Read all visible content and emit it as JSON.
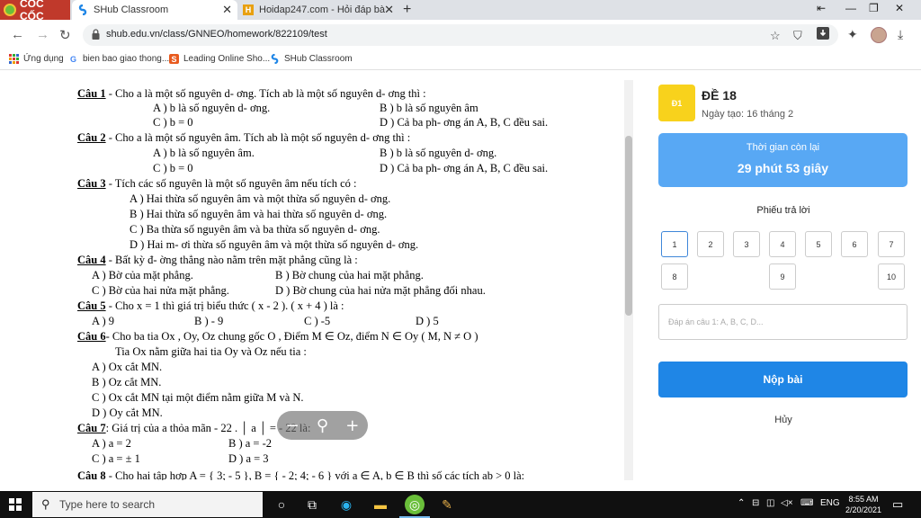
{
  "browser": {
    "brand": "CỐC CỐC",
    "tabs": [
      {
        "title": "SHub Classroom",
        "active": true
      },
      {
        "title": "Hoidap247.com - Hỏi đáp bà",
        "active": false
      }
    ],
    "url": "shub.edu.vn/class/GNNEO/homework/822109/test",
    "bookmarks": [
      "Ứng dụng",
      "bien bao giao thong...",
      "Leading Online Sho...",
      "SHub Classroom"
    ]
  },
  "document": {
    "lines": [
      {
        "label": "Câu 1",
        "text": " -  Cho a là một số nguyên d- ơng. Tích ab là một số nguyên d- ơng thì :"
      },
      {
        "text": "A )      b là số nguyên d- ơng."
      },
      {
        "text": "B )      b là số nguyên âm"
      },
      {
        "text": "C )      b = 0"
      },
      {
        "text": "D )      Cả ba ph- ơng án A, B, C đều sai."
      },
      {
        "label": "Câu 2",
        "text": " - Cho a là một số nguyên âm. Tích ab là một số nguyên d- ơng thì :"
      },
      {
        "text": "A )      b là số nguyên âm."
      },
      {
        "text": "B )      b là số nguyên d- ơng."
      },
      {
        "text": "C )      b = 0"
      },
      {
        "text": "D )      Cả ba ph- ơng án A, B, C đều sai."
      },
      {
        "label": "Câu 3",
        "text": " - Tích các số nguyên là một số nguyên âm nếu tích có :"
      },
      {
        "text": "A ) Hai thừa số nguyên âm và một thừa số nguyên d- ơng."
      },
      {
        "text": "B ) Hai thừa số nguyên âm và hai thừa số nguyên d- ơng."
      },
      {
        "text": "C ) Ba thừa số nguyên âm và ba thừa số nguyên d- ơng."
      },
      {
        "text": "D ) Hai m- ơi thừa số nguyên âm và một thừa số nguyên d- ơng."
      },
      {
        "label": "Câu 4",
        "text": " -   Bất kỳ đ- ờng thẳng nào nằm trên mặt phẳng cũng là :"
      },
      {
        "text": "A )    Bờ của mặt phẳng."
      },
      {
        "text": "B )    Bờ chung của hai mặt phẳng."
      },
      {
        "text": "C )    Bờ của hai nửa mặt phẳng."
      },
      {
        "text": "D )  Bờ chung của hai nửa mặt phẳng đối nhau."
      },
      {
        "label": "Câu 5",
        "text": " -  Cho x = 1 thì  giá trị biểu thức ( x - 2 ). ( x + 4 ) là :"
      },
      {
        "text": "A ) 9"
      },
      {
        "text": "B )     - 9"
      },
      {
        "text": "C )      -5"
      },
      {
        "text": "D )       5"
      },
      {
        "label": "Câu 6",
        "text": "-  Cho ba tia Ox , Oy, Oz  chung gốc O , Điểm M ∈ Oz, điểm N ∈ Oy ( M, N ≠ O )"
      },
      {
        "text": "Tia Ox nằm giữa hai tia Oy và Oz nếu tia :"
      },
      {
        "text": "A )  Ox cắt MN."
      },
      {
        "text": "B )  Oz cắt MN."
      },
      {
        "text": "C )  Ox cắt MN tại một điểm nằm giữa M và N."
      },
      {
        "text": "D )  Oy cắt MN."
      },
      {
        "label": "Câu 7",
        "text": ": Giá trị của a thỏa mãn - 22 . │ a │ = - 22 là:"
      },
      {
        "text": "A )  a = 2"
      },
      {
        "text": "B )      a = -2"
      },
      {
        "text": "C )   a = ± 1"
      },
      {
        "text": "D )      a = 3"
      },
      {
        "label": "Câu 8",
        "text": " -  Cho hai tập hợp A = { 3; - 5 },  B = { - 2; 4; - 6 }  với a ∈ A, b ∈ B thì  số các tích ab > 0 là:"
      }
    ],
    "zoom_controls": {
      "minus": "−",
      "zoom_icon": "⚲",
      "plus": "+"
    }
  },
  "sidebar": {
    "badge": "Đ1",
    "title": "ĐỀ 18",
    "date": "Ngày tạo: 16 tháng 2",
    "timer_label": "Thời gian còn lại",
    "timer_value": "29 phút 53 giây",
    "answer_sheet_title": "Phiếu trả lời",
    "questions": [
      "1",
      "2",
      "3",
      "4",
      "5",
      "6",
      "7",
      "8",
      "9",
      "10"
    ],
    "active_question": "1",
    "answer_placeholder": "Đáp án câu 1: A, B, C, D...",
    "submit_label": "Nộp bài",
    "cancel_label": "Hủy"
  },
  "taskbar": {
    "search_placeholder": "Type here to search",
    "language": "ENG",
    "time": "8:55 AM",
    "date": "2/20/2021"
  },
  "colors": {
    "accent_blue": "#1f86e6",
    "timer_blue": "#58a8f4",
    "badge_yellow": "#f8d21c"
  }
}
